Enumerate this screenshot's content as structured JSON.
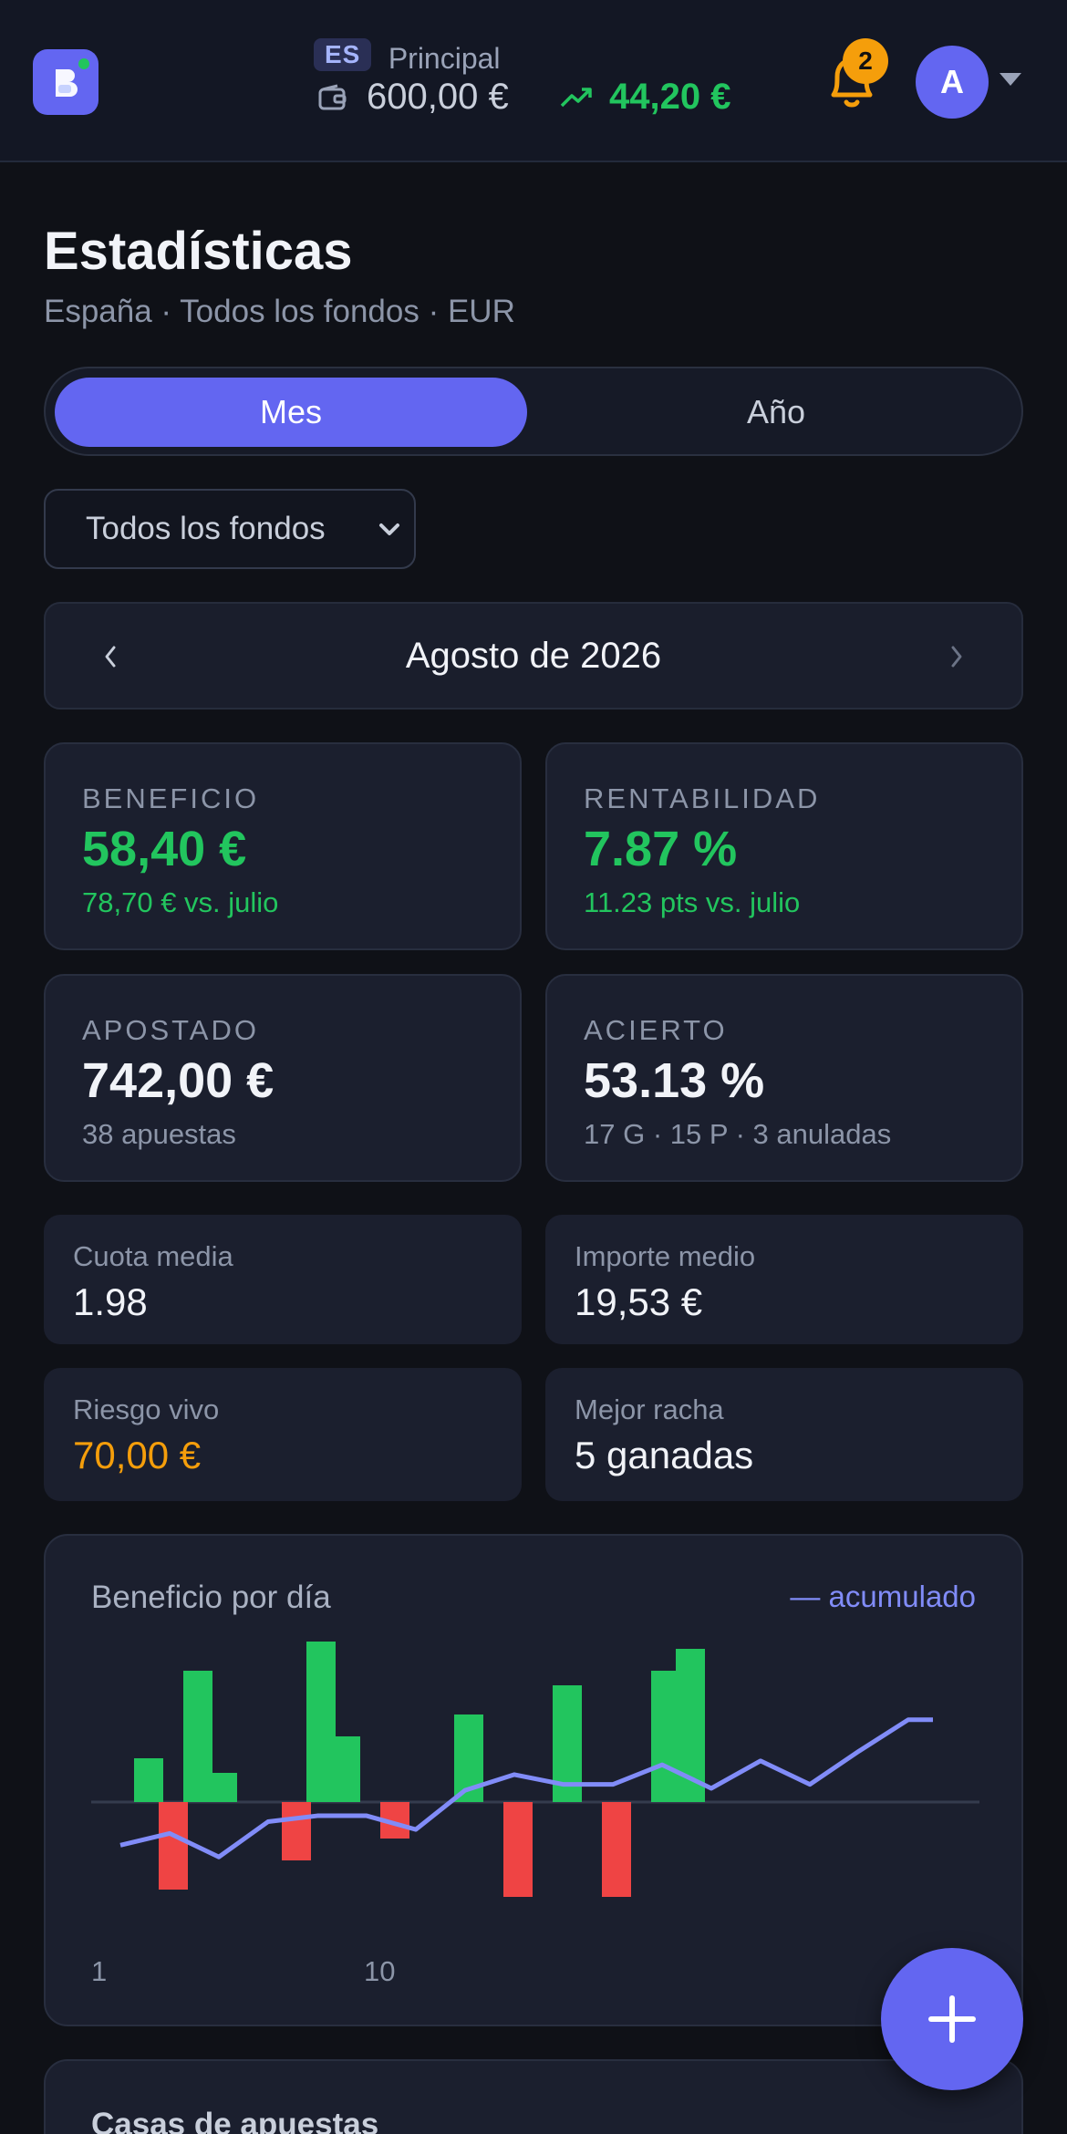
{
  "header": {
    "country_code": "ES",
    "account_name": "Principal",
    "balance": "600,00 €",
    "profit": "44,20 €",
    "notifications_count": "2",
    "avatar_initial": "A"
  },
  "page": {
    "title": "Estadísticas",
    "subtitle": "España · Todos los fondos · EUR"
  },
  "period_toggle": {
    "month_label": "Mes",
    "year_label": "Año",
    "selected": "Mes"
  },
  "fund_select": {
    "value": "Todos los fondos"
  },
  "month_nav": {
    "label": "Agosto de 2026"
  },
  "cards": {
    "beneficio": {
      "label": "BENEFICIO",
      "value": "58,40 €",
      "sub": "78,70 € vs. julio"
    },
    "rentabilidad": {
      "label": "RENTABILIDAD",
      "value": "7.87 %",
      "sub": "11.23 pts vs. julio"
    },
    "apostado": {
      "label": "APOSTADO",
      "value": "742,00 €",
      "sub": "38 apuestas"
    },
    "acierto": {
      "label": "ACIERTO",
      "value": "53.13 %",
      "sub": "17 G · 15 P · 3 anuladas"
    }
  },
  "mini": {
    "cuota": {
      "label": "Cuota media",
      "value": "1.98"
    },
    "importe": {
      "label": "Importe medio",
      "value": "19,53 €"
    },
    "riesgo": {
      "label": "Riesgo vivo",
      "value": "70,00 €"
    },
    "racha": {
      "label": "Mejor racha",
      "value": "5 ganadas"
    }
  },
  "colors": {
    "accent": "#6366f1",
    "positive": "#22c55e",
    "negative": "#ef4444",
    "warning": "#f59e0b",
    "line": "#818cf8"
  },
  "chart_data": {
    "type": "bar",
    "title": "Beneficio por día",
    "legend": "— acumulado",
    "x_tick_labels": [
      "1",
      "10"
    ],
    "x": [
      1,
      2,
      3,
      4,
      5,
      6,
      7,
      8,
      9,
      10,
      11,
      12,
      13,
      14,
      15,
      16,
      17,
      18,
      19,
      20,
      21,
      22,
      23,
      24,
      25,
      26,
      27,
      28,
      29,
      30,
      31
    ],
    "series": [
      {
        "kind": "bar",
        "values": [
          0,
          6,
          -12,
          18,
          4,
          0,
          0,
          -8,
          22,
          9,
          0,
          -5,
          0,
          0,
          12,
          0,
          -13,
          0,
          16,
          0,
          -13,
          0,
          18,
          21,
          0,
          0,
          0,
          0,
          0,
          0,
          0
        ]
      },
      {
        "name": "acumulado",
        "kind": "line",
        "values": [
          -11,
          -8,
          -14,
          -5,
          -3.5,
          -3.5,
          -7,
          3,
          7,
          4.5,
          4.5,
          9.5,
          3.5,
          10.5,
          4.5,
          13,
          21,
          21
        ]
      }
    ]
  },
  "next_section": {
    "title": "Casas de apuestas"
  }
}
